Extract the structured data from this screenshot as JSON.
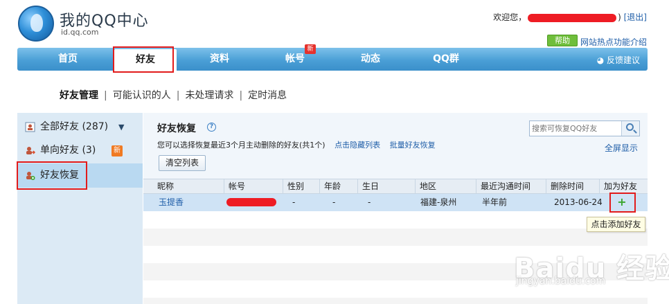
{
  "header": {
    "title": "我的QQ中心",
    "subtitle": "id.qq.com",
    "welcome": "欢迎您，",
    "name_suffix": ")",
    "logout": "[退出]",
    "help_label": "帮助",
    "help_text": "网站热点功能介绍"
  },
  "nav": {
    "items": [
      "首页",
      "好友",
      "资料",
      "帐号",
      "动态",
      "QQ群"
    ],
    "active": "好友",
    "new_badge": "新",
    "feedback": "反馈建议"
  },
  "subnav": {
    "items": [
      "好友管理",
      "可能认识的人",
      "未处理请求",
      "定时消息"
    ],
    "separator": "|"
  },
  "sidebar": {
    "items": [
      {
        "label": "全部好友 (287)"
      },
      {
        "label": "单向好友 (3)",
        "badge": "新"
      },
      {
        "label": "好友恢复"
      }
    ]
  },
  "main": {
    "title": "好友恢复",
    "help_glyph": "?",
    "description": "您可以选择恢复最近3个月主动删除的好友(共1个)",
    "link_hidden": "点击隐藏列表",
    "link_batch": "批量好友恢复",
    "clear_button": "清空列表",
    "search_placeholder": "搜索可恢复QQ好友",
    "fullscreen": "全屏显示"
  },
  "table": {
    "columns": [
      "昵称",
      "帐号",
      "性别",
      "年龄",
      "生日",
      "地区",
      "最近沟通时间",
      "删除时间",
      "加为好友"
    ],
    "rows": [
      {
        "nickname": "玉提香",
        "gender": "-",
        "age": "-",
        "birthday": "-",
        "region": "福建-泉州",
        "last_contact": "半年前",
        "deleted": "2013-06-24",
        "add": "+"
      }
    ],
    "tooltip": "点击添加好友"
  },
  "watermark": {
    "main": "Baidu 经验",
    "sub": "jingyan.baidu.com"
  },
  "colors": {
    "nav_blue": "#4a9fd6",
    "link_blue": "#1f5ea8",
    "highlight_red": "#e21b1b",
    "add_green": "#3aa52c"
  }
}
